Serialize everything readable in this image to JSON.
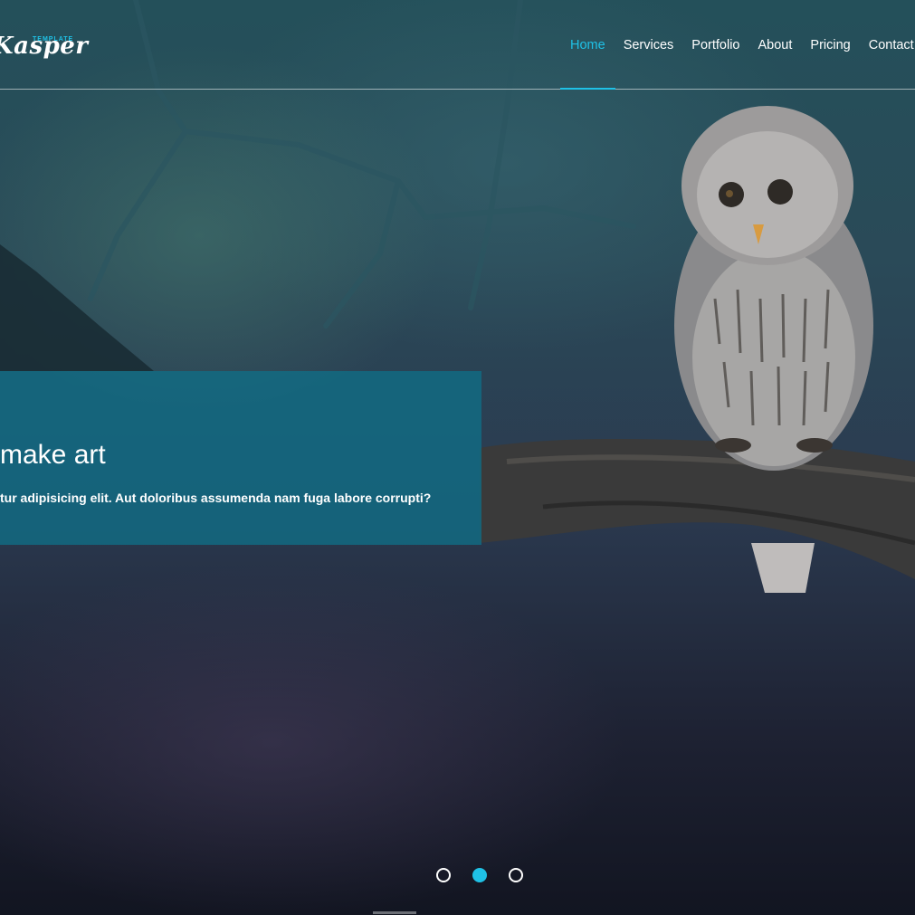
{
  "logo": {
    "text": "Kasper",
    "sup": "TEMPLATE"
  },
  "nav": {
    "items": [
      "Home",
      "Services",
      "Portfolio",
      "About",
      "Pricing",
      "Contact"
    ],
    "active_index": 0
  },
  "slide": {
    "title": "make art",
    "text": "tur adipisicing elit. Aut doloribus assumenda nam fuga labore corrupti?"
  },
  "slider": {
    "count": 3,
    "active_index": 1
  },
  "colors": {
    "accent": "#1fc1e6",
    "caption_bg": "#106e87"
  }
}
